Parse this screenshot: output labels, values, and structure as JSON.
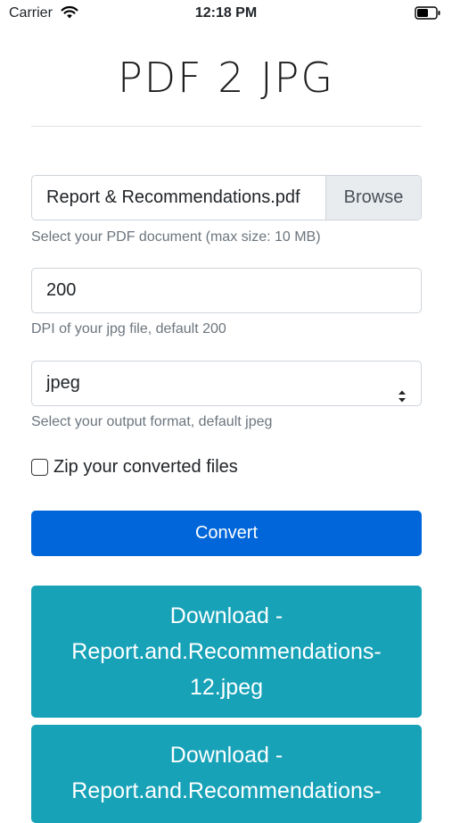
{
  "status_bar": {
    "carrier": "Carrier",
    "time": "12:18 PM"
  },
  "title": "PDF 2 JPG",
  "file_input": {
    "file_name": "Report & Recommendations.pdf",
    "browse_label": "Browse",
    "help": "Select your PDF document (max size: 10 MB)"
  },
  "dpi": {
    "value": "200",
    "help": "DPI of your jpg file, default 200"
  },
  "format": {
    "selected": "jpeg",
    "help": "Select your output format, default jpeg"
  },
  "zip": {
    "label": "Zip your converted files"
  },
  "convert_label": "Convert",
  "downloads": [
    {
      "line1": "Download -",
      "line2": "Report.and.Recommendations-",
      "line3": "12.jpeg"
    },
    {
      "line1": "Download -",
      "line2": "Report.and.Recommendations-"
    }
  ]
}
